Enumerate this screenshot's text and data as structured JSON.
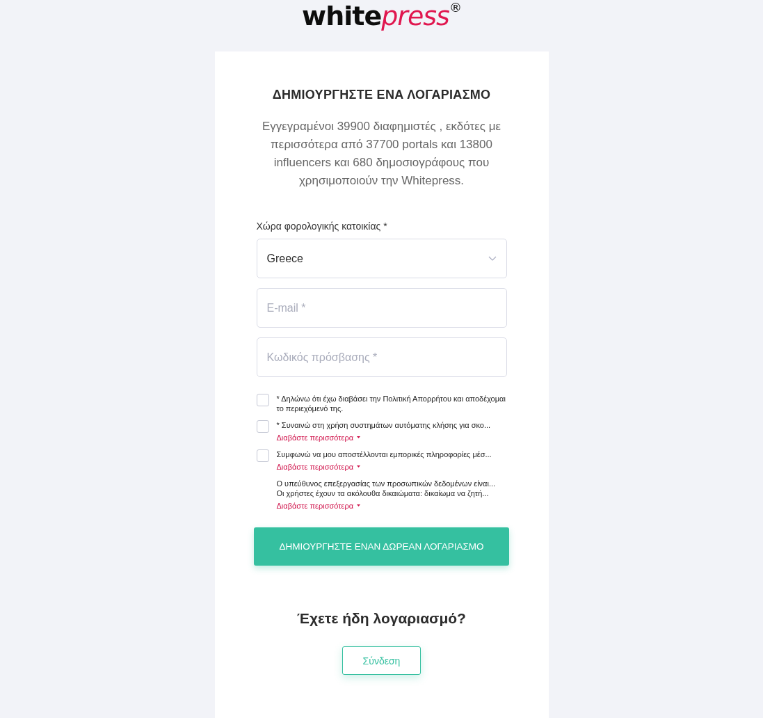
{
  "logo": {
    "main": "white",
    "accent": "press",
    "mark": "®"
  },
  "title": "ΔΗΜΙΟΥΡΓΗΣΤΕ ΕΝΑ ΛΟΓΑΡΙΑΣΜΟ",
  "intro": "Εγγεγραμένοι 39900 διαφημιστές , εκδότες με περισσότερα από 37700 portals και 13800 influencers και 680 δημοσιογράφους που χρησιμοποιούν την Whitepress.",
  "country": {
    "label": "Χώρα φορολογικής κατοικίας *",
    "value": "Greece"
  },
  "fields": [
    {
      "placeholder": "E-mail *"
    },
    {
      "placeholder": "Κωδικός πρόσβασης *"
    }
  ],
  "consents": [
    {
      "kind": "checkbox",
      "checked": false,
      "lines": [
        "* Δηλώνω ότι έχω διαβάσει την Πολιτική Απορρήτου και αποδέχομαι το περιεχόμενό της."
      ]
    },
    {
      "kind": "checkbox",
      "checked": false,
      "lines": [
        "* Συναινώ στη χρήση συστημάτων αυτόματης κλήσης για σκο..."
      ],
      "more": "Διαβάστε περισσότερα"
    },
    {
      "kind": "checkbox",
      "checked": false,
      "lines": [
        "Συμφωνώ να μου αποστέλλονται εμπορικές πληροφορίες μέσ..."
      ],
      "more": "Διαβάστε περισσότερα"
    },
    {
      "kind": "note",
      "lines": [
        "Ο υπεύθυνος επεξεργασίας των προσωπικών δεδομένων είναι...",
        "Οι χρήστες έχουν τα ακόλουθα δικαιώματα: δικαίωμα να ζητή..."
      ],
      "more": "Διαβάστε περισσότερα"
    }
  ],
  "submit": "ΔΗΜΙΟΥΡΓΗΣΤΕ ΕΝΑΝ ΔΩΡΕΑΝ ΛΟΓΑΡΙΑΣΜΟ",
  "login_prompt": "Έχετε ήδη λογαριασμό?",
  "login_button": "Σύνδεση"
}
